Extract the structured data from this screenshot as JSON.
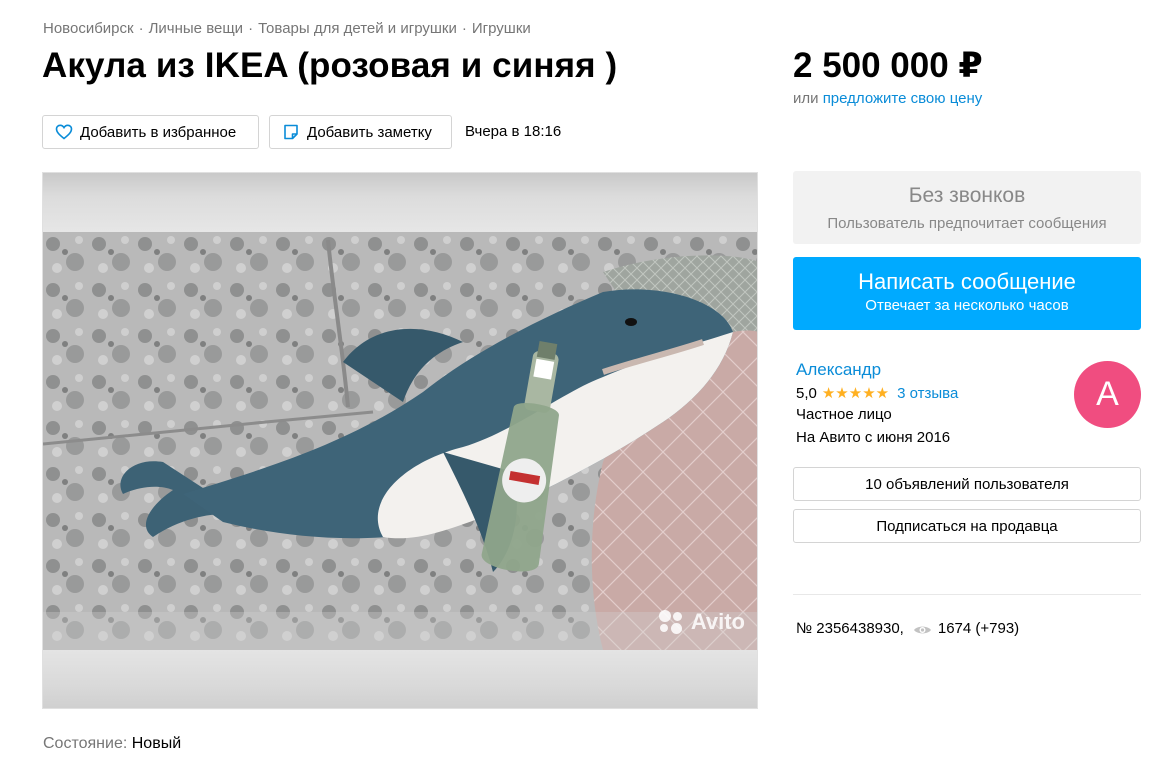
{
  "breadcrumbs": [
    "Новосибирск",
    "Личные вещи",
    "Товары для детей и игрушки",
    "Игрушки"
  ],
  "breadcrumb_separator": "·",
  "title": "Акула из IKEA (розовая и синяя )",
  "price": {
    "amount": "2 500 000 ₽",
    "prefix": "или",
    "offer_link": "предложите свою цену"
  },
  "actions": {
    "favorite_label": "Добавить в избранное",
    "note_label": "Добавить заметку",
    "date": "Вчера в 18:16"
  },
  "photo": {
    "watermark": "Avito",
    "description_icon": "photo-shark-plush"
  },
  "condition": {
    "label": "Состояние:",
    "value": "Новый"
  },
  "contact": {
    "no_calls_title": "Без звонков",
    "no_calls_subtitle": "Пользователь предпочитает сообщения",
    "message_button": "Написать сообщение",
    "message_subtitle": "Отвечает за несколько часов"
  },
  "seller": {
    "name": "Александр",
    "rating": "5,0",
    "stars": "★★★★★",
    "reviews": "3 отзыва",
    "type": "Частное лицо",
    "since": "На Авито с июня 2016",
    "avatar_letter": "А",
    "ads_button": "10 объявлений пользователя",
    "subscribe_button": "Подписаться на продавца"
  },
  "meta": {
    "item_number": "№ 2356438930,",
    "views": "1674 (+793)"
  },
  "colors": {
    "accent_blue": "#00aaff",
    "link_blue": "#0a8cd8",
    "avatar_pink": "#f04d80",
    "star_yellow": "#ffb021"
  }
}
